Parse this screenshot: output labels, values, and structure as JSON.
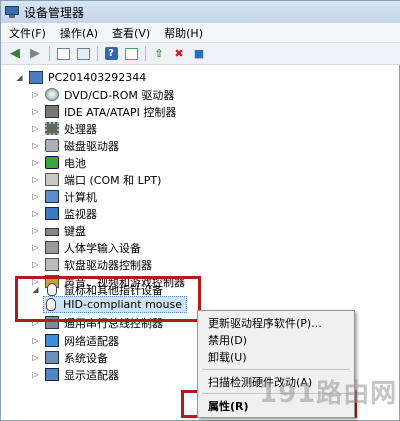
{
  "window": {
    "title": "设备管理器"
  },
  "menu": [
    "文件(F)",
    "操作(A)",
    "查看(V)",
    "帮助(H)"
  ],
  "toolbar": {
    "icons": [
      "back-icon",
      "forward-icon",
      "properties-view-icon",
      "show-hidden-icon",
      "help-icon",
      "scan-icon",
      "update-driver-icon",
      "disable-device-icon",
      "uninstall-icon"
    ]
  },
  "tree": {
    "root": "PC201403292344",
    "items": [
      {
        "label": "DVD/CD-ROM 驱动器",
        "icon": "dvd-icon"
      },
      {
        "label": "IDE ATA/ATAPI 控制器",
        "icon": "ide-controller-icon"
      },
      {
        "label": "处理器",
        "icon": "processor-icon"
      },
      {
        "label": "磁盘驱动器",
        "icon": "disk-drive-icon"
      },
      {
        "label": "电池",
        "icon": "battery-icon"
      },
      {
        "label": "端口 (COM 和 LPT)",
        "icon": "port-icon"
      },
      {
        "label": "计算机",
        "icon": "computer-icon"
      },
      {
        "label": "监视器",
        "icon": "monitor-icon"
      },
      {
        "label": "键盘",
        "icon": "keyboard-icon"
      },
      {
        "label": "人体学输入设备",
        "icon": "hid-icon"
      },
      {
        "label": "软盘驱动器控制器",
        "icon": "floppy-controller-icon"
      },
      {
        "label": "声音、视频和游戏控制器",
        "icon": "sound-icon"
      },
      {
        "label": "鼠标和其他指针设备",
        "icon": "mouse-icon"
      },
      {
        "label": "HID-compliant mouse",
        "icon": "mouse-icon"
      },
      {
        "label": "通用串行总线控制器",
        "icon": "usb-icon"
      },
      {
        "label": "网络适配器",
        "icon": "network-icon"
      },
      {
        "label": "系统设备",
        "icon": "system-device-icon"
      },
      {
        "label": "显示适配器",
        "icon": "display-adapter-icon"
      }
    ]
  },
  "context_menu": {
    "items": [
      "更新驱动程序软件(P)...",
      "禁用(D)",
      "卸载(U)",
      "扫描检测硬件改动(A)",
      "属性(R)"
    ]
  },
  "watermark": "191路由网",
  "colors": {
    "highlight": "#b01c1c",
    "selection": "#cfe3f7"
  }
}
